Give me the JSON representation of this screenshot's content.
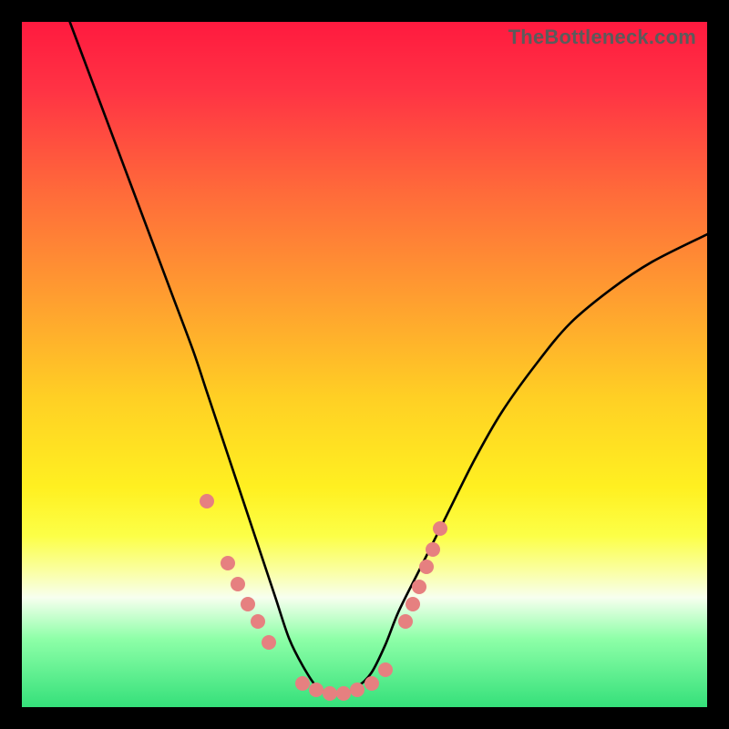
{
  "watermark": "TheBottleneck.com",
  "colors": {
    "marker": "#e68080",
    "curve": "#000000",
    "gradient_stops": [
      {
        "pos": 0.0,
        "color": "#ff1a3f"
      },
      {
        "pos": 0.1,
        "color": "#ff3344"
      },
      {
        "pos": 0.25,
        "color": "#ff6b3a"
      },
      {
        "pos": 0.4,
        "color": "#ff9d30"
      },
      {
        "pos": 0.55,
        "color": "#ffd024"
      },
      {
        "pos": 0.68,
        "color": "#fff021"
      },
      {
        "pos": 0.75,
        "color": "#fcff47"
      },
      {
        "pos": 0.8,
        "color": "#faffa0"
      },
      {
        "pos": 0.84,
        "color": "#f7ffef"
      },
      {
        "pos": 0.9,
        "color": "#8effa8"
      },
      {
        "pos": 1.0,
        "color": "#35e07a"
      }
    ]
  },
  "chart_data": {
    "type": "line",
    "title": "",
    "xlabel": "",
    "ylabel": "",
    "xlim": [
      0,
      100
    ],
    "ylim": [
      0,
      100
    ],
    "x": [
      7,
      10,
      13,
      16,
      19,
      22,
      25,
      27,
      29,
      31,
      33,
      35,
      37,
      39,
      41,
      43,
      45,
      47,
      49,
      51,
      53,
      55,
      58,
      62,
      66,
      70,
      75,
      80,
      86,
      92,
      100
    ],
    "y": [
      100,
      92,
      84,
      76,
      68,
      60,
      52,
      46,
      40,
      34,
      28,
      22,
      16,
      10,
      6,
      3,
      2,
      2,
      3,
      5,
      9,
      14,
      20,
      28,
      36,
      43,
      50,
      56,
      61,
      65,
      69
    ],
    "markers": [
      {
        "x": 27.0,
        "y": 30.0
      },
      {
        "x": 30.0,
        "y": 21.0
      },
      {
        "x": 31.5,
        "y": 18.0
      },
      {
        "x": 33.0,
        "y": 15.0
      },
      {
        "x": 34.5,
        "y": 12.5
      },
      {
        "x": 36.0,
        "y": 9.5
      },
      {
        "x": 41.0,
        "y": 3.5
      },
      {
        "x": 43.0,
        "y": 2.5
      },
      {
        "x": 45.0,
        "y": 2.0
      },
      {
        "x": 47.0,
        "y": 2.0
      },
      {
        "x": 49.0,
        "y": 2.5
      },
      {
        "x": 51.0,
        "y": 3.5
      },
      {
        "x": 53.0,
        "y": 5.5
      },
      {
        "x": 56.0,
        "y": 12.5
      },
      {
        "x": 57.0,
        "y": 15.0
      },
      {
        "x": 58.0,
        "y": 17.5
      },
      {
        "x": 59.0,
        "y": 20.5
      },
      {
        "x": 60.0,
        "y": 23.0
      },
      {
        "x": 61.0,
        "y": 26.0
      }
    ]
  }
}
